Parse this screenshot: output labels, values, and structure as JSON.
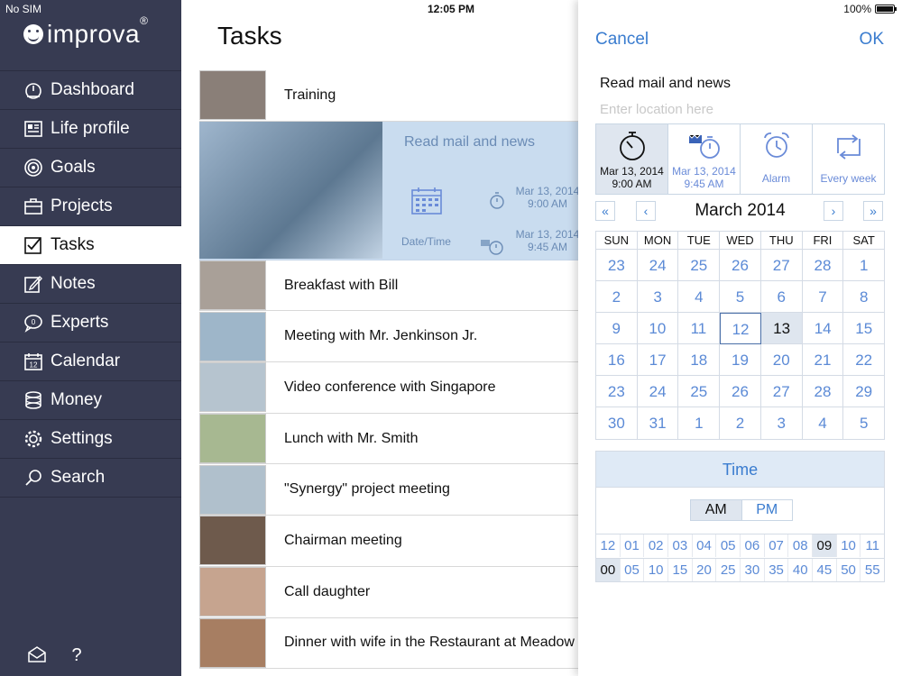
{
  "status": {
    "carrier": "No SIM",
    "time": "12:05 PM",
    "battery": "100%"
  },
  "sidebar": {
    "brand": "improva",
    "brand_mark": "®",
    "items": [
      {
        "label": "Dashboard",
        "icon": "dashboard-icon"
      },
      {
        "label": "Life profile",
        "icon": "profile-icon"
      },
      {
        "label": "Goals",
        "icon": "target-icon"
      },
      {
        "label": "Projects",
        "icon": "briefcase-icon"
      },
      {
        "label": "Tasks",
        "icon": "checkbox-icon",
        "active": true
      },
      {
        "label": "Notes",
        "icon": "notes-icon"
      },
      {
        "label": "Experts",
        "icon": "chat-icon"
      },
      {
        "label": "Calendar",
        "icon": "calendar-icon"
      },
      {
        "label": "Money",
        "icon": "coins-icon"
      },
      {
        "label": "Settings",
        "icon": "gear-icon"
      },
      {
        "label": "Search",
        "icon": "search-icon"
      }
    ],
    "calendar_badge": "12"
  },
  "main": {
    "title": "Tasks",
    "tasks": [
      {
        "label": "Training",
        "thumb": "#8a7f78"
      },
      {
        "label": "Read mail and news",
        "expanded": true
      },
      {
        "label": "Breakfast with Bill",
        "thumb": "#a9a098"
      },
      {
        "label": "Meeting with Mr. Jenkinson Jr.",
        "thumb": "#9eb6c9"
      },
      {
        "label": "Video conference with Singapore",
        "thumb": "#b6c4cf"
      },
      {
        "label": "Lunch with Mr. Smith",
        "thumb": "#a7b891"
      },
      {
        "label": "\"Synergy\" project meeting",
        "thumb": "#b0c0cc"
      },
      {
        "label": "Chairman meeting",
        "thumb": "#6e5a4c"
      },
      {
        "label": "Call daughter",
        "thumb": "#c6a48f"
      },
      {
        "label": "Dinner with wife in the Restaurant at Meadow",
        "thumb": "#a77e62"
      }
    ],
    "expanded": {
      "title": "Read mail and news",
      "datetime_label": "Date/Time",
      "start": {
        "date": "Mar 13, 2014",
        "time": "9:00 AM"
      },
      "end": {
        "date": "Mar 13, 2014",
        "time": "9:45 AM"
      }
    }
  },
  "panel": {
    "cancel": "Cancel",
    "ok": "OK",
    "subject": "Read mail and news",
    "location_placeholder": "Enter location here",
    "location_value": "",
    "options": [
      {
        "icon": "stopwatch-icon",
        "line1": "Mar 13, 2014",
        "line2": "9:00 AM",
        "selected": true
      },
      {
        "icon": "finish-stopwatch-icon",
        "line1": "Mar 13, 2014",
        "line2": "9:45 AM"
      },
      {
        "icon": "alarm-clock-icon",
        "line1": "Alarm",
        "line2": ""
      },
      {
        "icon": "repeat-icon",
        "line1": "Every week",
        "line2": ""
      }
    ],
    "month_title": "March 2014",
    "nav": {
      "first": "«",
      "prev": "‹",
      "next": "›",
      "last": "»"
    },
    "weekdays": [
      "SUN",
      "MON",
      "TUE",
      "WED",
      "THU",
      "FRI",
      "SAT"
    ],
    "weeks": [
      [
        "23",
        "24",
        "25",
        "26",
        "27",
        "28",
        "1"
      ],
      [
        "2",
        "3",
        "4",
        "5",
        "6",
        "7",
        "8"
      ],
      [
        "9",
        "10",
        "11",
        "12",
        "13",
        "14",
        "15"
      ],
      [
        "16",
        "17",
        "18",
        "19",
        "20",
        "21",
        "22"
      ],
      [
        "23",
        "24",
        "25",
        "26",
        "27",
        "28",
        "29"
      ],
      [
        "30",
        "31",
        "1",
        "2",
        "3",
        "4",
        "5"
      ]
    ],
    "today": "12",
    "selected_day": "13",
    "time": {
      "title": "Time",
      "am": "AM",
      "pm": "PM",
      "hours": [
        "12",
        "01",
        "02",
        "03",
        "04",
        "05",
        "06",
        "07",
        "08",
        "09",
        "10",
        "11"
      ],
      "selected_hour": "09",
      "minutes": [
        "00",
        "05",
        "10",
        "15",
        "20",
        "25",
        "30",
        "35",
        "40",
        "45",
        "50",
        "55"
      ],
      "selected_minute": "00"
    }
  },
  "colors": {
    "sidebar": "#373b52",
    "accent": "#3a7ccf",
    "selected": "#dfe6ef",
    "expanded_row": "#c9dcef"
  }
}
